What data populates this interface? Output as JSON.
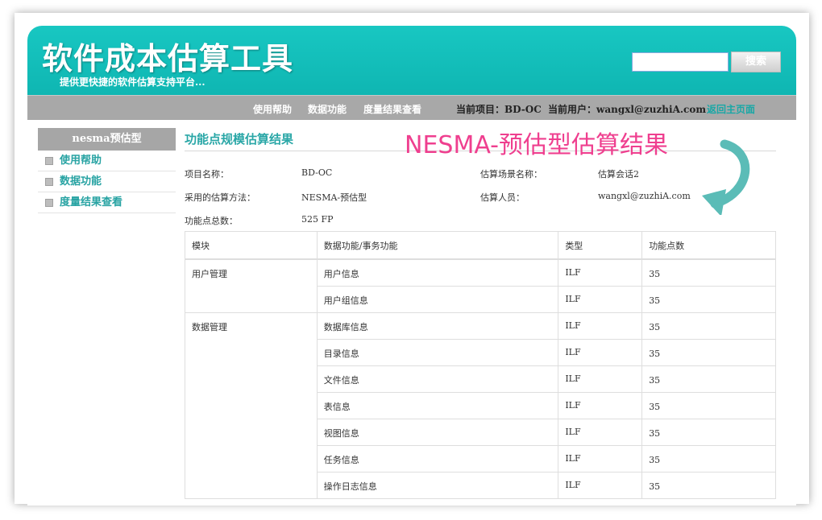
{
  "header": {
    "title": "软件成本估算工具",
    "subtitle": "提供更快捷的软件估算支持平台...",
    "search_placeholder": "",
    "search_button": "搜索"
  },
  "nav": {
    "help": "使用帮助",
    "data_func": "数据功能",
    "measure_view": "度量结果查看",
    "current_project": "当前项目：BD-OC",
    "current_user": "当前用户：wangxl@zuzhiA.com",
    "home": "返回主页面"
  },
  "sidebar": {
    "title": "nesma预估型",
    "items": [
      {
        "label": "使用帮助"
      },
      {
        "label": "数据功能"
      },
      {
        "label": "度量结果查看"
      }
    ]
  },
  "main": {
    "title": "功能点规模估算结果",
    "banner": "NESMA-预估型估算结果",
    "info": {
      "project_name_label": "项目名称：",
      "project_name": "BD-OC",
      "scenario_label": "估算场景名称：",
      "scenario": "估算会话2",
      "method_label": "采用的估算方法：",
      "method": "NESMA-预估型",
      "estimator_label": "估算人员：",
      "estimator": "wangxl@zuzhiA.com",
      "total_label": "功能点总数：",
      "total": "525 FP"
    },
    "table": {
      "headers": [
        "模块",
        "数据功能/事务功能",
        "类型",
        "功能点数"
      ],
      "groups": [
        {
          "module": "用户管理",
          "rows": [
            {
              "func": "用户信息",
              "type": "ILF",
              "fp": "35"
            },
            {
              "func": "用户组信息",
              "type": "ILF",
              "fp": "35"
            }
          ]
        },
        {
          "module": "数据管理",
          "rows": [
            {
              "func": "数据库信息",
              "type": "ILF",
              "fp": "35"
            },
            {
              "func": "目录信息",
              "type": "ILF",
              "fp": "35"
            },
            {
              "func": "文件信息",
              "type": "ILF",
              "fp": "35"
            },
            {
              "func": "表信息",
              "type": "ILF",
              "fp": "35"
            },
            {
              "func": "视图信息",
              "type": "ILF",
              "fp": "35"
            },
            {
              "func": "任务信息",
              "type": "ILF",
              "fp": "35"
            },
            {
              "func": "操作日志信息",
              "type": "ILF",
              "fp": "35"
            }
          ]
        }
      ]
    }
  },
  "colors": {
    "header": "#18c7c2",
    "accent": "#2aa7a7",
    "banner": "#ef3f8f",
    "nav": "#a8a8a8"
  },
  "icons": [
    "curved-arrow-icon",
    "square-bullet-icon"
  ]
}
